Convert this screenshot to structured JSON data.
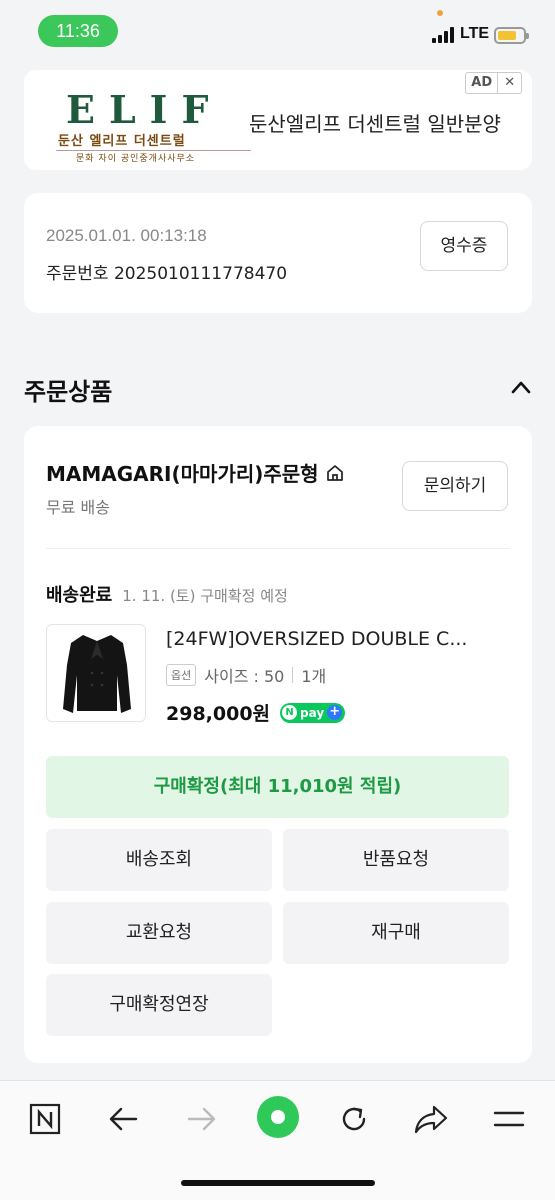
{
  "status_bar": {
    "time": "11:36",
    "network": "LTE",
    "battery_color": "#f2c230",
    "time_pill_color": "#3cc75a"
  },
  "ad": {
    "logo_word": "ELIF",
    "logo_sub1": "둔산 엘리프 더센트럴",
    "logo_sub2": "문화 자이 공인중개사사무소",
    "text": "둔산엘리프 더센트럴 일반분양",
    "badge_label": "AD",
    "close_label": "✕"
  },
  "order": {
    "date": "2025.01.01. 00:13:18",
    "number_label": "주문번호 2025010111778470",
    "receipt_label": "영수증"
  },
  "section": {
    "title": "주문상품"
  },
  "seller": {
    "name": "MAMAGARI(마마가리)주문형",
    "shipping": "무료 배송",
    "inquiry_label": "문의하기"
  },
  "item": {
    "delivery_status": "배송완료",
    "delivery_note": "1. 11. (토) 구매확정 예정",
    "name": "[24FW]OVERSIZED DOUBLE C...",
    "option_tag": "옵션",
    "option_text": "사이즈 : 50",
    "quantity": "1개",
    "price": "298,000원",
    "npay_label": "pay",
    "npay_n": "N",
    "npay_plus": "+"
  },
  "actions": {
    "confirm": "구매확정(최대 11,010원 적립)",
    "track": "배송조회",
    "return": "반품요청",
    "exchange": "교환요청",
    "reorder": "재구매",
    "extend": "구매확정연장"
  },
  "colors": {
    "accent_green": "#1e9a44",
    "confirm_bg": "#e2f6e6",
    "toolbar_green": "#2fc95a"
  },
  "toolbar": {
    "items": [
      "naver-home-icon",
      "back-icon",
      "forward-icon",
      "green-dot-icon",
      "refresh-icon",
      "share-icon",
      "menu-icon"
    ]
  }
}
